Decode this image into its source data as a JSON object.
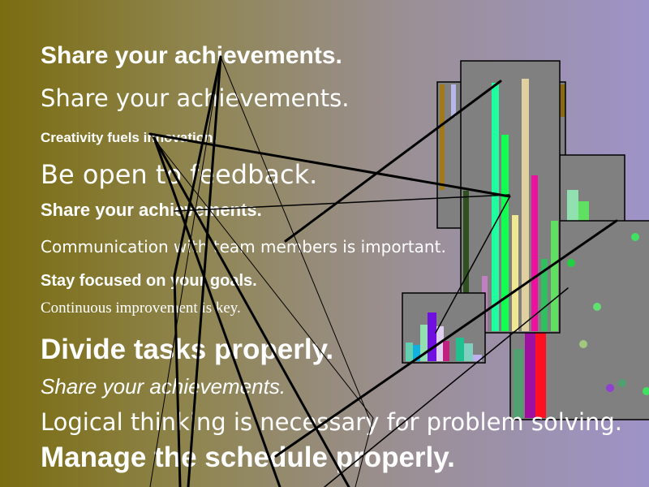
{
  "texts": {
    "t1": "Share your achievements.",
    "t2": "Share your achievements.",
    "t3": "Creativity fuels innovation.",
    "t4": "Be open to feedback.",
    "t5": "Share your achievements.",
    "t6": "Communication with team members is important.",
    "t7": "Stay focused on your goals.",
    "t8": "Continuous improvement is key.",
    "t9": "Divide tasks properly.",
    "t10": "Share your achievements.",
    "t11": "Logical thinking is necessary for problem solving.",
    "t12": "Manage the schedule properly."
  },
  "colors": {
    "text": "#ffffff",
    "panel": "#808080",
    "panel_border": "#000000",
    "lines": "#000000"
  }
}
